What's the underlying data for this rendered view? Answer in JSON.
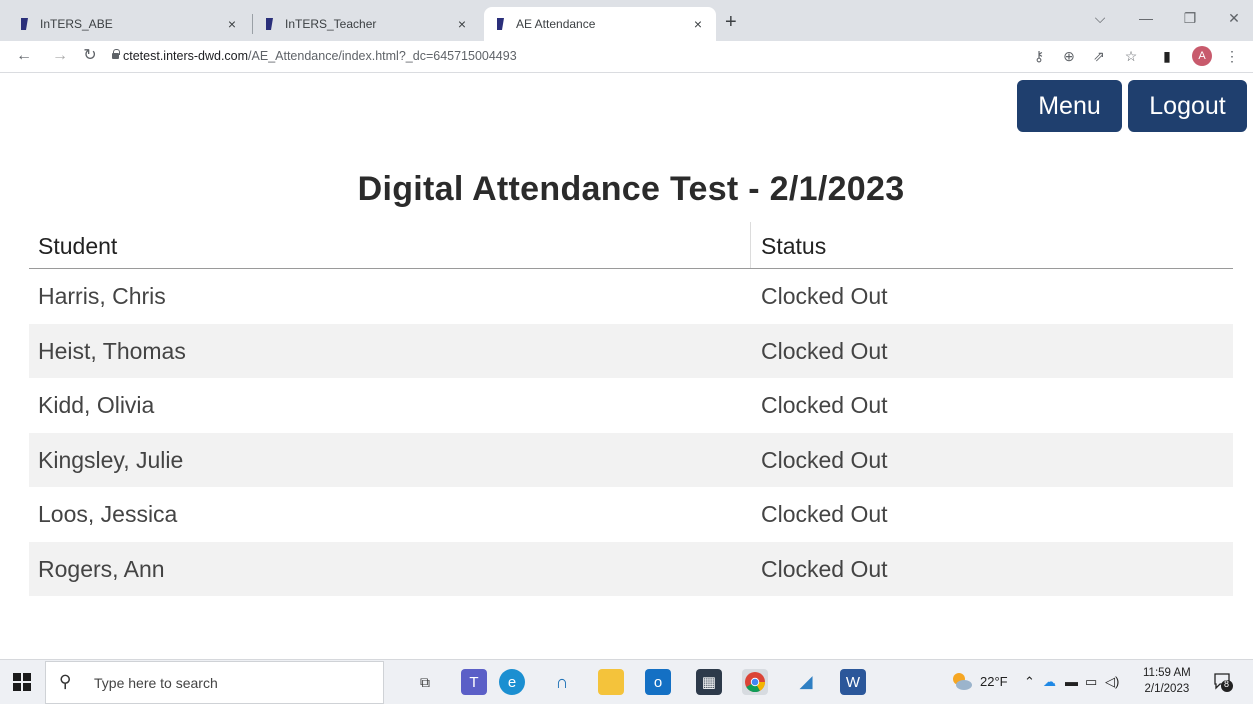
{
  "browser": {
    "tabs": [
      {
        "title": "InTERS_ABE",
        "close": "×"
      },
      {
        "title": "InTERS_Teacher",
        "close": "×"
      },
      {
        "title": "AE Attendance",
        "close": "×"
      }
    ],
    "new_tab": "+",
    "window_controls": {
      "dropdown": "⌵",
      "minimize": "—",
      "restore": "❐",
      "close": "✕"
    },
    "nav": {
      "back": "←",
      "forward": "→",
      "reload": "↻"
    },
    "url_host": "ctetest.inters-dwd.com",
    "url_path": "/AE_Attendance/index.html?_dc=645715004493",
    "toolbar_icons": {
      "key": "⚷",
      "zoom": "⊕",
      "share": "⇗",
      "bookmark": "☆",
      "sidepanel": "▮",
      "menu": "⋮"
    },
    "profile_initial": "A"
  },
  "header": {
    "menu_label": "Menu",
    "logout_label": "Logout"
  },
  "page_title": "Digital Attendance Test - 2/1/2023",
  "table": {
    "columns": [
      "Student",
      "Status"
    ],
    "rows": [
      {
        "student": "Harris, Chris",
        "status": "Clocked Out"
      },
      {
        "student": "Heist, Thomas",
        "status": "Clocked Out"
      },
      {
        "student": "Kidd, Olivia",
        "status": "Clocked Out"
      },
      {
        "student": "Kingsley, Julie",
        "status": "Clocked Out"
      },
      {
        "student": "Loos, Jessica",
        "status": "Clocked Out"
      },
      {
        "student": "Rogers, Ann",
        "status": "Clocked Out"
      }
    ]
  },
  "taskbar": {
    "search_placeholder": "Type here to search",
    "weather": "22°F",
    "time": "11:59 AM",
    "date": "2/1/2023",
    "notification_count": "8"
  },
  "colors": {
    "button_bg": "#1f3f6e",
    "row_alt": "#f2f2f2"
  }
}
